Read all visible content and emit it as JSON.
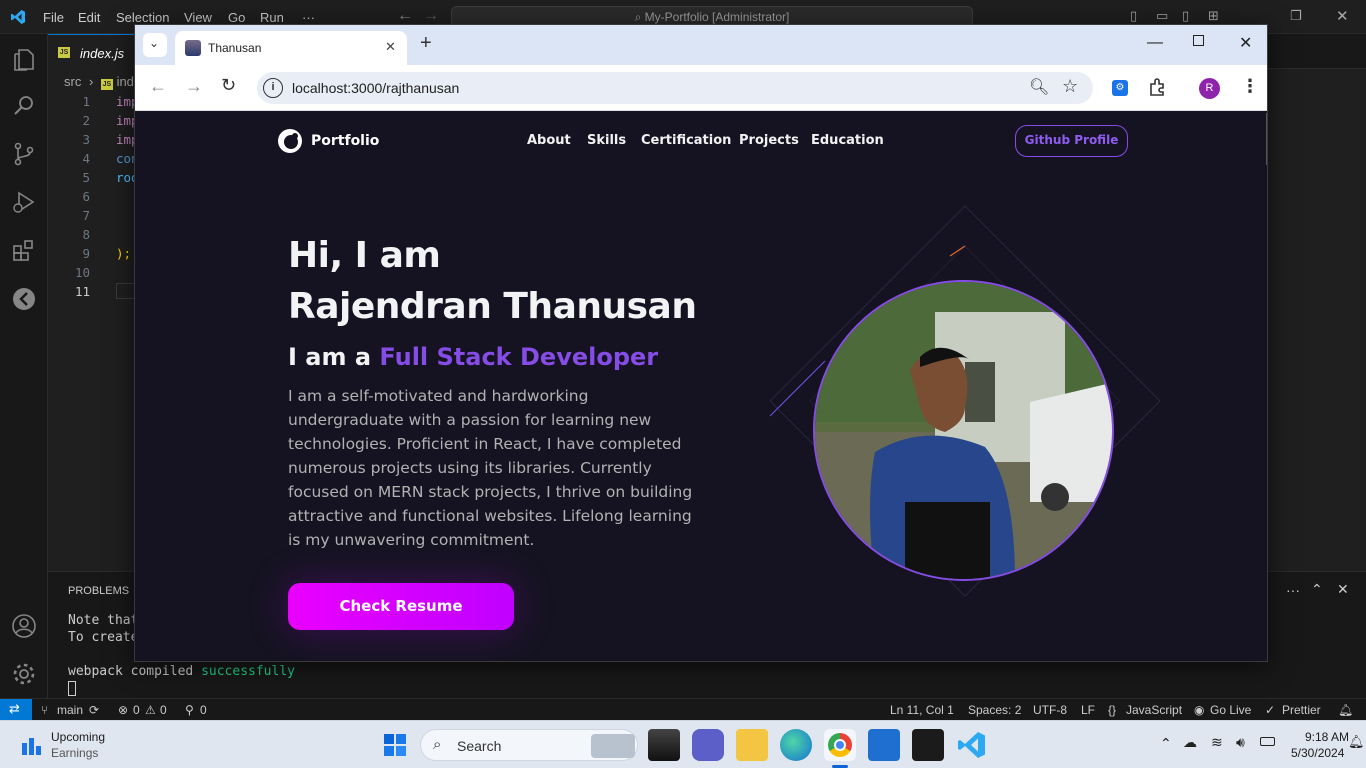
{
  "vscode": {
    "menu": [
      "File",
      "Edit",
      "Selection",
      "View",
      "Go",
      "Run",
      "···"
    ],
    "search_text": "My-Portfolio [Administrator]",
    "tab_label": "index.js",
    "breadcrumb": {
      "folder": "src",
      "file": "ind"
    },
    "lines": [
      "1",
      "2",
      "3",
      "4",
      "5",
      "6",
      "7",
      "8",
      "9",
      "10",
      "11"
    ],
    "code": {
      "l1": "imp",
      "l2": "imp",
      "l3": "imp",
      "l4": "con",
      "l5": "roo",
      "l9": ");"
    },
    "panel": {
      "title": "PROBLEMS",
      "note1": "Note that",
      "note2": "To create",
      "compiled_prefix": "webpack compiled",
      "compiled_status": "successfully"
    },
    "status": {
      "branch": "main",
      "errors": "0",
      "warnings": "0",
      "ports": "0",
      "cursor": "Ln 11, Col 1",
      "spaces": "Spaces: 2",
      "encoding": "UTF-8",
      "eol": "LF",
      "language": "JavaScript",
      "golive": "Go Live",
      "prettier": "Prettier"
    }
  },
  "browser": {
    "tab_title": "Thanusan",
    "url": "localhost:3000/rajthanusan",
    "profile_letter": "R"
  },
  "site": {
    "logo": "Portfolio",
    "nav": [
      "About",
      "Skills",
      "Certification",
      "Projects",
      "Education"
    ],
    "github_button": "Github Profile",
    "greeting": "Hi, I am",
    "name": "Rajendran Thanusan",
    "role_prefix": "I am a",
    "role": "Full Stack Developer",
    "description": "I am a self-motivated and hardworking undergraduate with a passion for learning new technologies. Proficient in React, I have completed numerous projects using its libraries. Currently focused on MERN stack projects, I thrive on building attractive and functional websites. Lifelong learning is my unwavering commitment.",
    "cta": "Check Resume"
  },
  "taskbar": {
    "widget_title": "Upcoming",
    "widget_sub": "Earnings",
    "search": "Search",
    "time": "9:18 AM",
    "date": "5/30/2024"
  },
  "colors": {
    "accent": "#854ce6",
    "cta": "#e000ff",
    "vscode_blue": "#0078d4"
  }
}
